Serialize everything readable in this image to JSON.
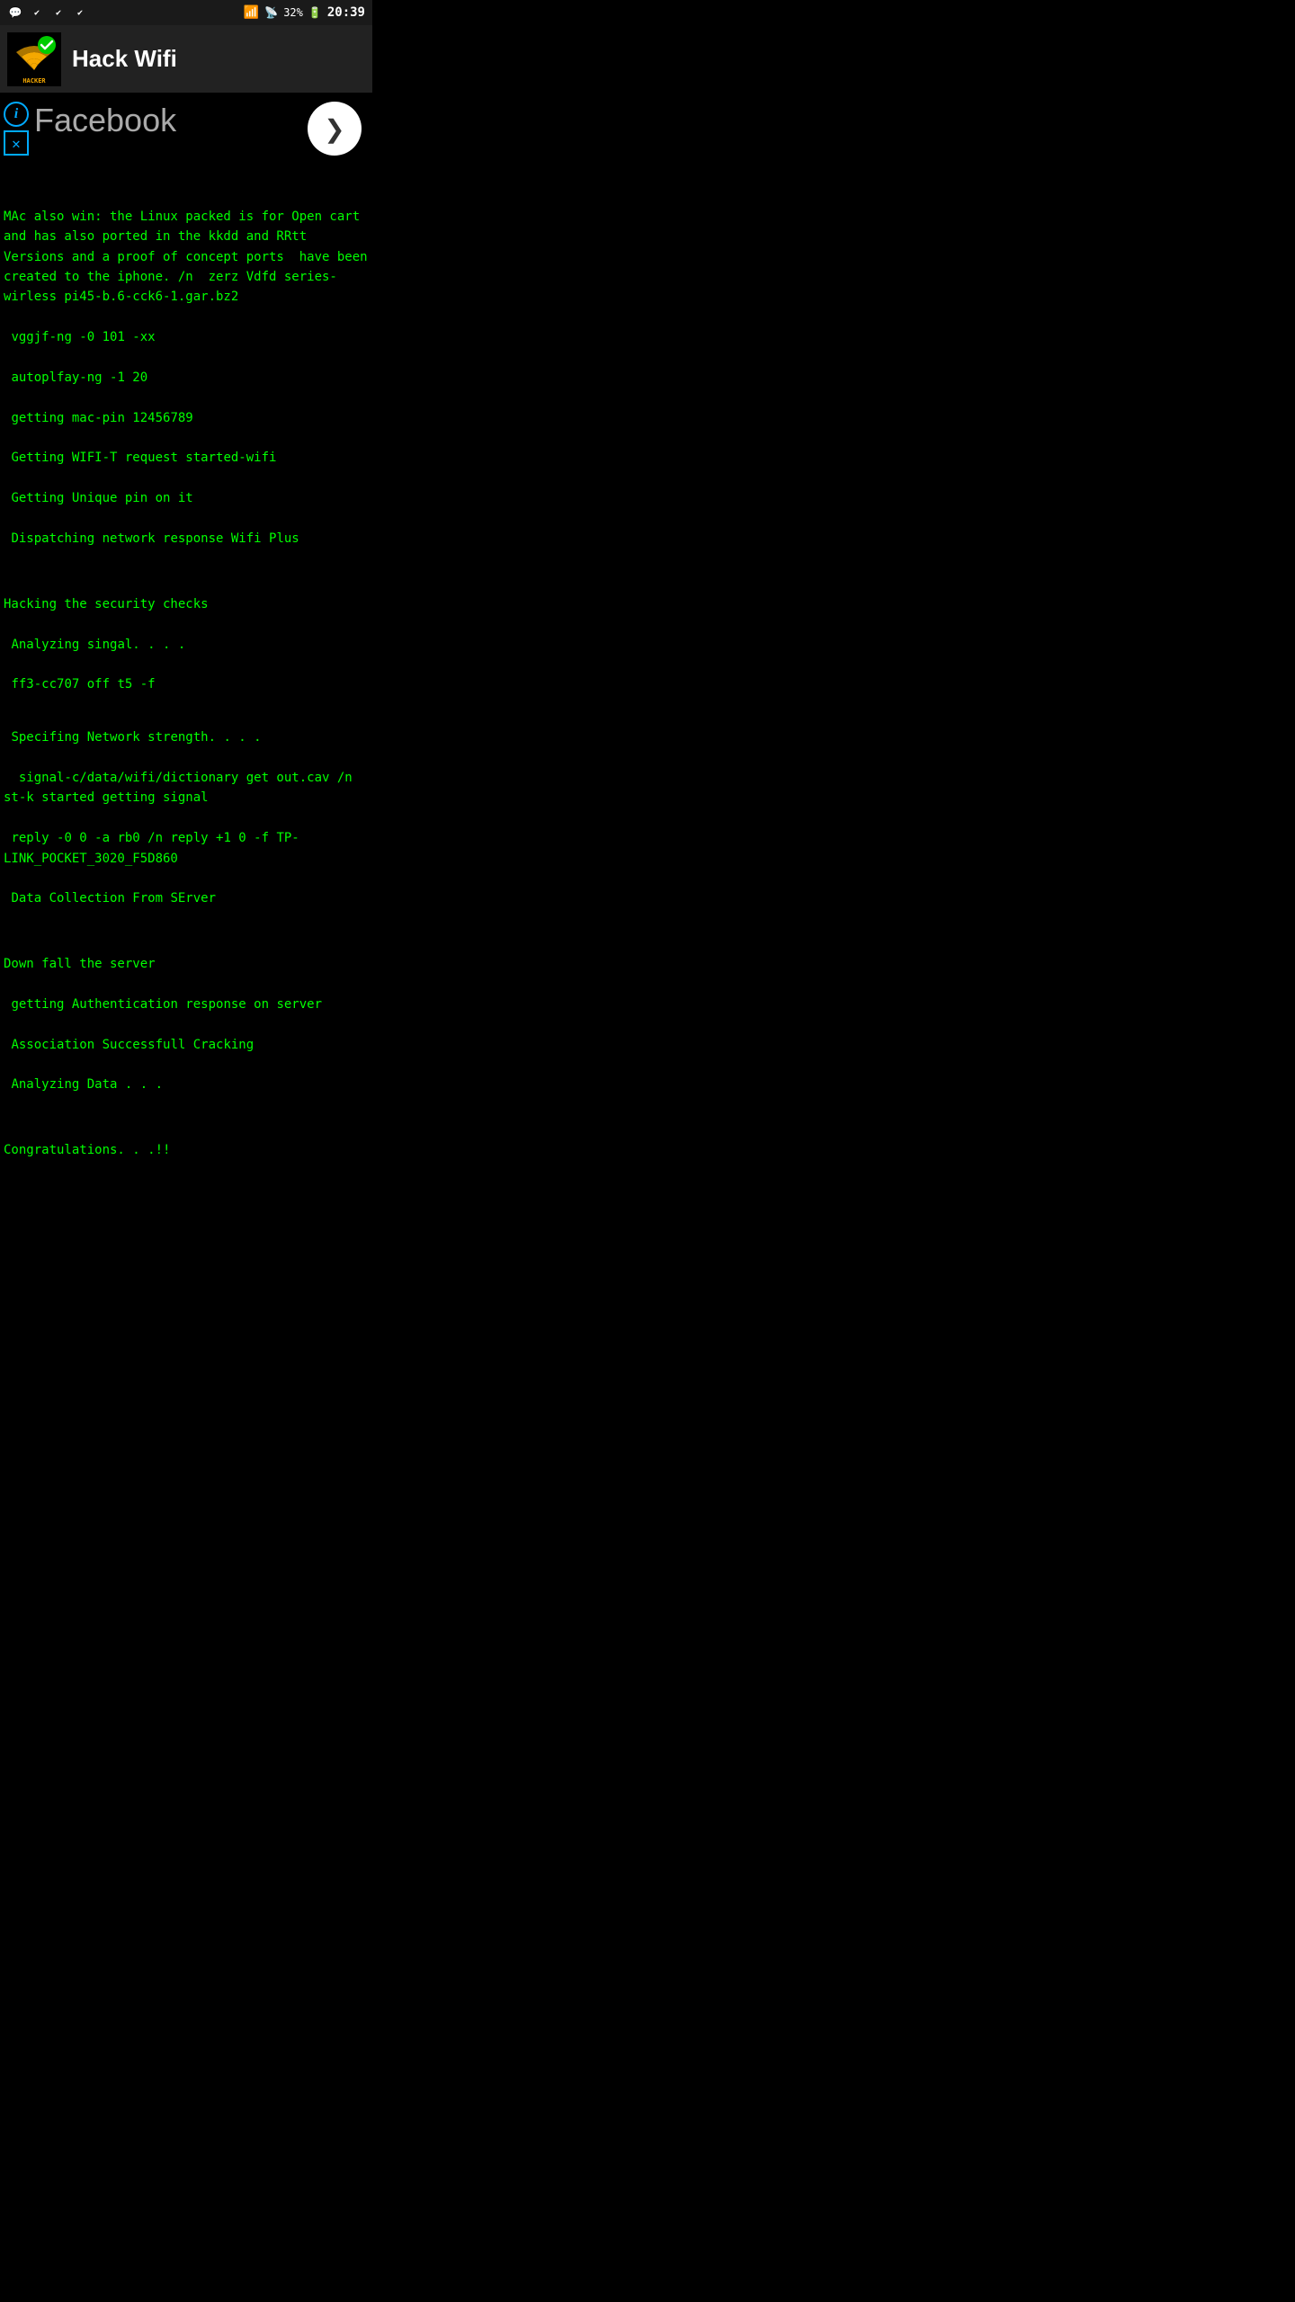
{
  "statusBar": {
    "time": "20:39",
    "battery": "32%",
    "icons": [
      "messenger",
      "check1",
      "check2",
      "check3",
      "wifi",
      "signal",
      "battery"
    ]
  },
  "header": {
    "title": "Hack Wifi",
    "logoText": "HACKER"
  },
  "adBanner": {
    "label": "Facebook",
    "infoIcon": "i",
    "closeIcon": "✕",
    "nextArrow": "❯"
  },
  "terminal": {
    "lines": [
      "MAc also win: the Linux packed is for Open cart and has also ported in the kkdd and RRtt Versions and a proof of concept ports  have been created to the iphone. /n  zerz Vdfd series-wirless pi45-b.6-cck6-1.gar.bz2",
      " vggjf-ng -0 101 -xx",
      " autoplfay-ng -1 20",
      " getting mac-pin 12456789",
      " Getting WIFI-T request started-wifi",
      " Getting Unique pin on it",
      " Dispatching network response Wifi Plus",
      "",
      "",
      "Hacking the security checks",
      " Analyzing singal. . . .",
      " ff3-cc707 off t5 -f",
      "",
      " Specifing Network strength. . . .",
      "  signal-c/data/wifi/dictionary get out.cav /n st-k started getting signal",
      " reply -0 0 -a rb0 /n reply +1 0 -f TP-LINK_POCKET_3020_F5D860",
      " Data Collection From SErver",
      "",
      "",
      "Down fall the server",
      " getting Authentication response on server",
      " Association Successfull Cracking",
      " Analyzing Data . . .",
      "",
      "",
      "Congratulations. . .!!"
    ]
  }
}
